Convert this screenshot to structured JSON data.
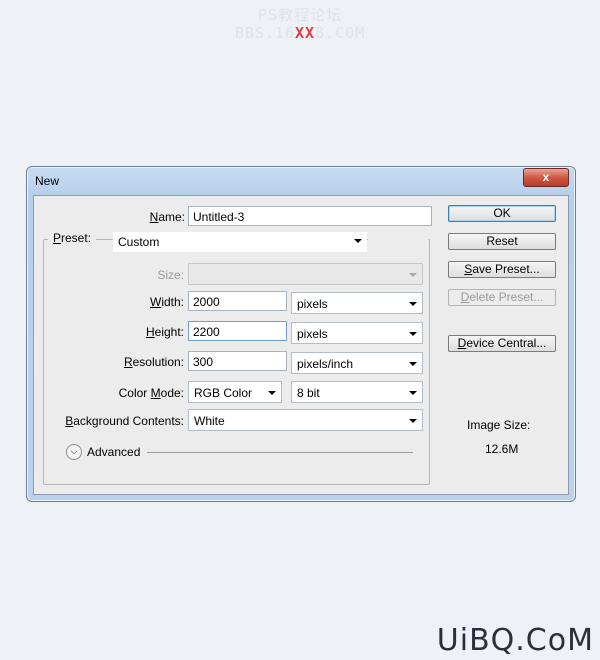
{
  "watermark": {
    "line1": "PS教程论坛",
    "line2_prefix": "BBS.16",
    "line2_xx": "XX",
    "line2_suffix": "8.COM",
    "bottom": "UiBQ.CoM"
  },
  "dialog": {
    "title": "New",
    "close_label": "x"
  },
  "form": {
    "name_label": "Name:",
    "name_value": "Untitled-3",
    "preset_label": "Preset:",
    "preset_value": "Custom",
    "size_label": "Size:",
    "size_value": "",
    "width_label": "Width:",
    "width_value": "2000",
    "width_unit": "pixels",
    "height_label": "Height:",
    "height_value": "2200",
    "height_unit": "pixels",
    "resolution_label": "Resolution:",
    "resolution_value": "300",
    "resolution_unit": "pixels/inch",
    "color_mode_label": "Color Mode:",
    "color_mode_value": "RGB Color",
    "bit_depth_value": "8 bit",
    "background_label": "Background Contents:",
    "background_value": "White",
    "advanced_label": "Advanced"
  },
  "buttons": {
    "ok": "OK",
    "reset": "Reset",
    "save_preset": "Save Preset...",
    "delete_preset": "Delete Preset...",
    "device_central": "Device Central..."
  },
  "image_size": {
    "label": "Image Size:",
    "value": "12.6M"
  },
  "colors": {
    "title_bar": "#bcd3ec",
    "close_button": "#cf5a45",
    "default_button_border": "#3c7fb1"
  },
  "icons": [
    "close-icon",
    "chevron-down-icon",
    "expand-icon"
  ]
}
